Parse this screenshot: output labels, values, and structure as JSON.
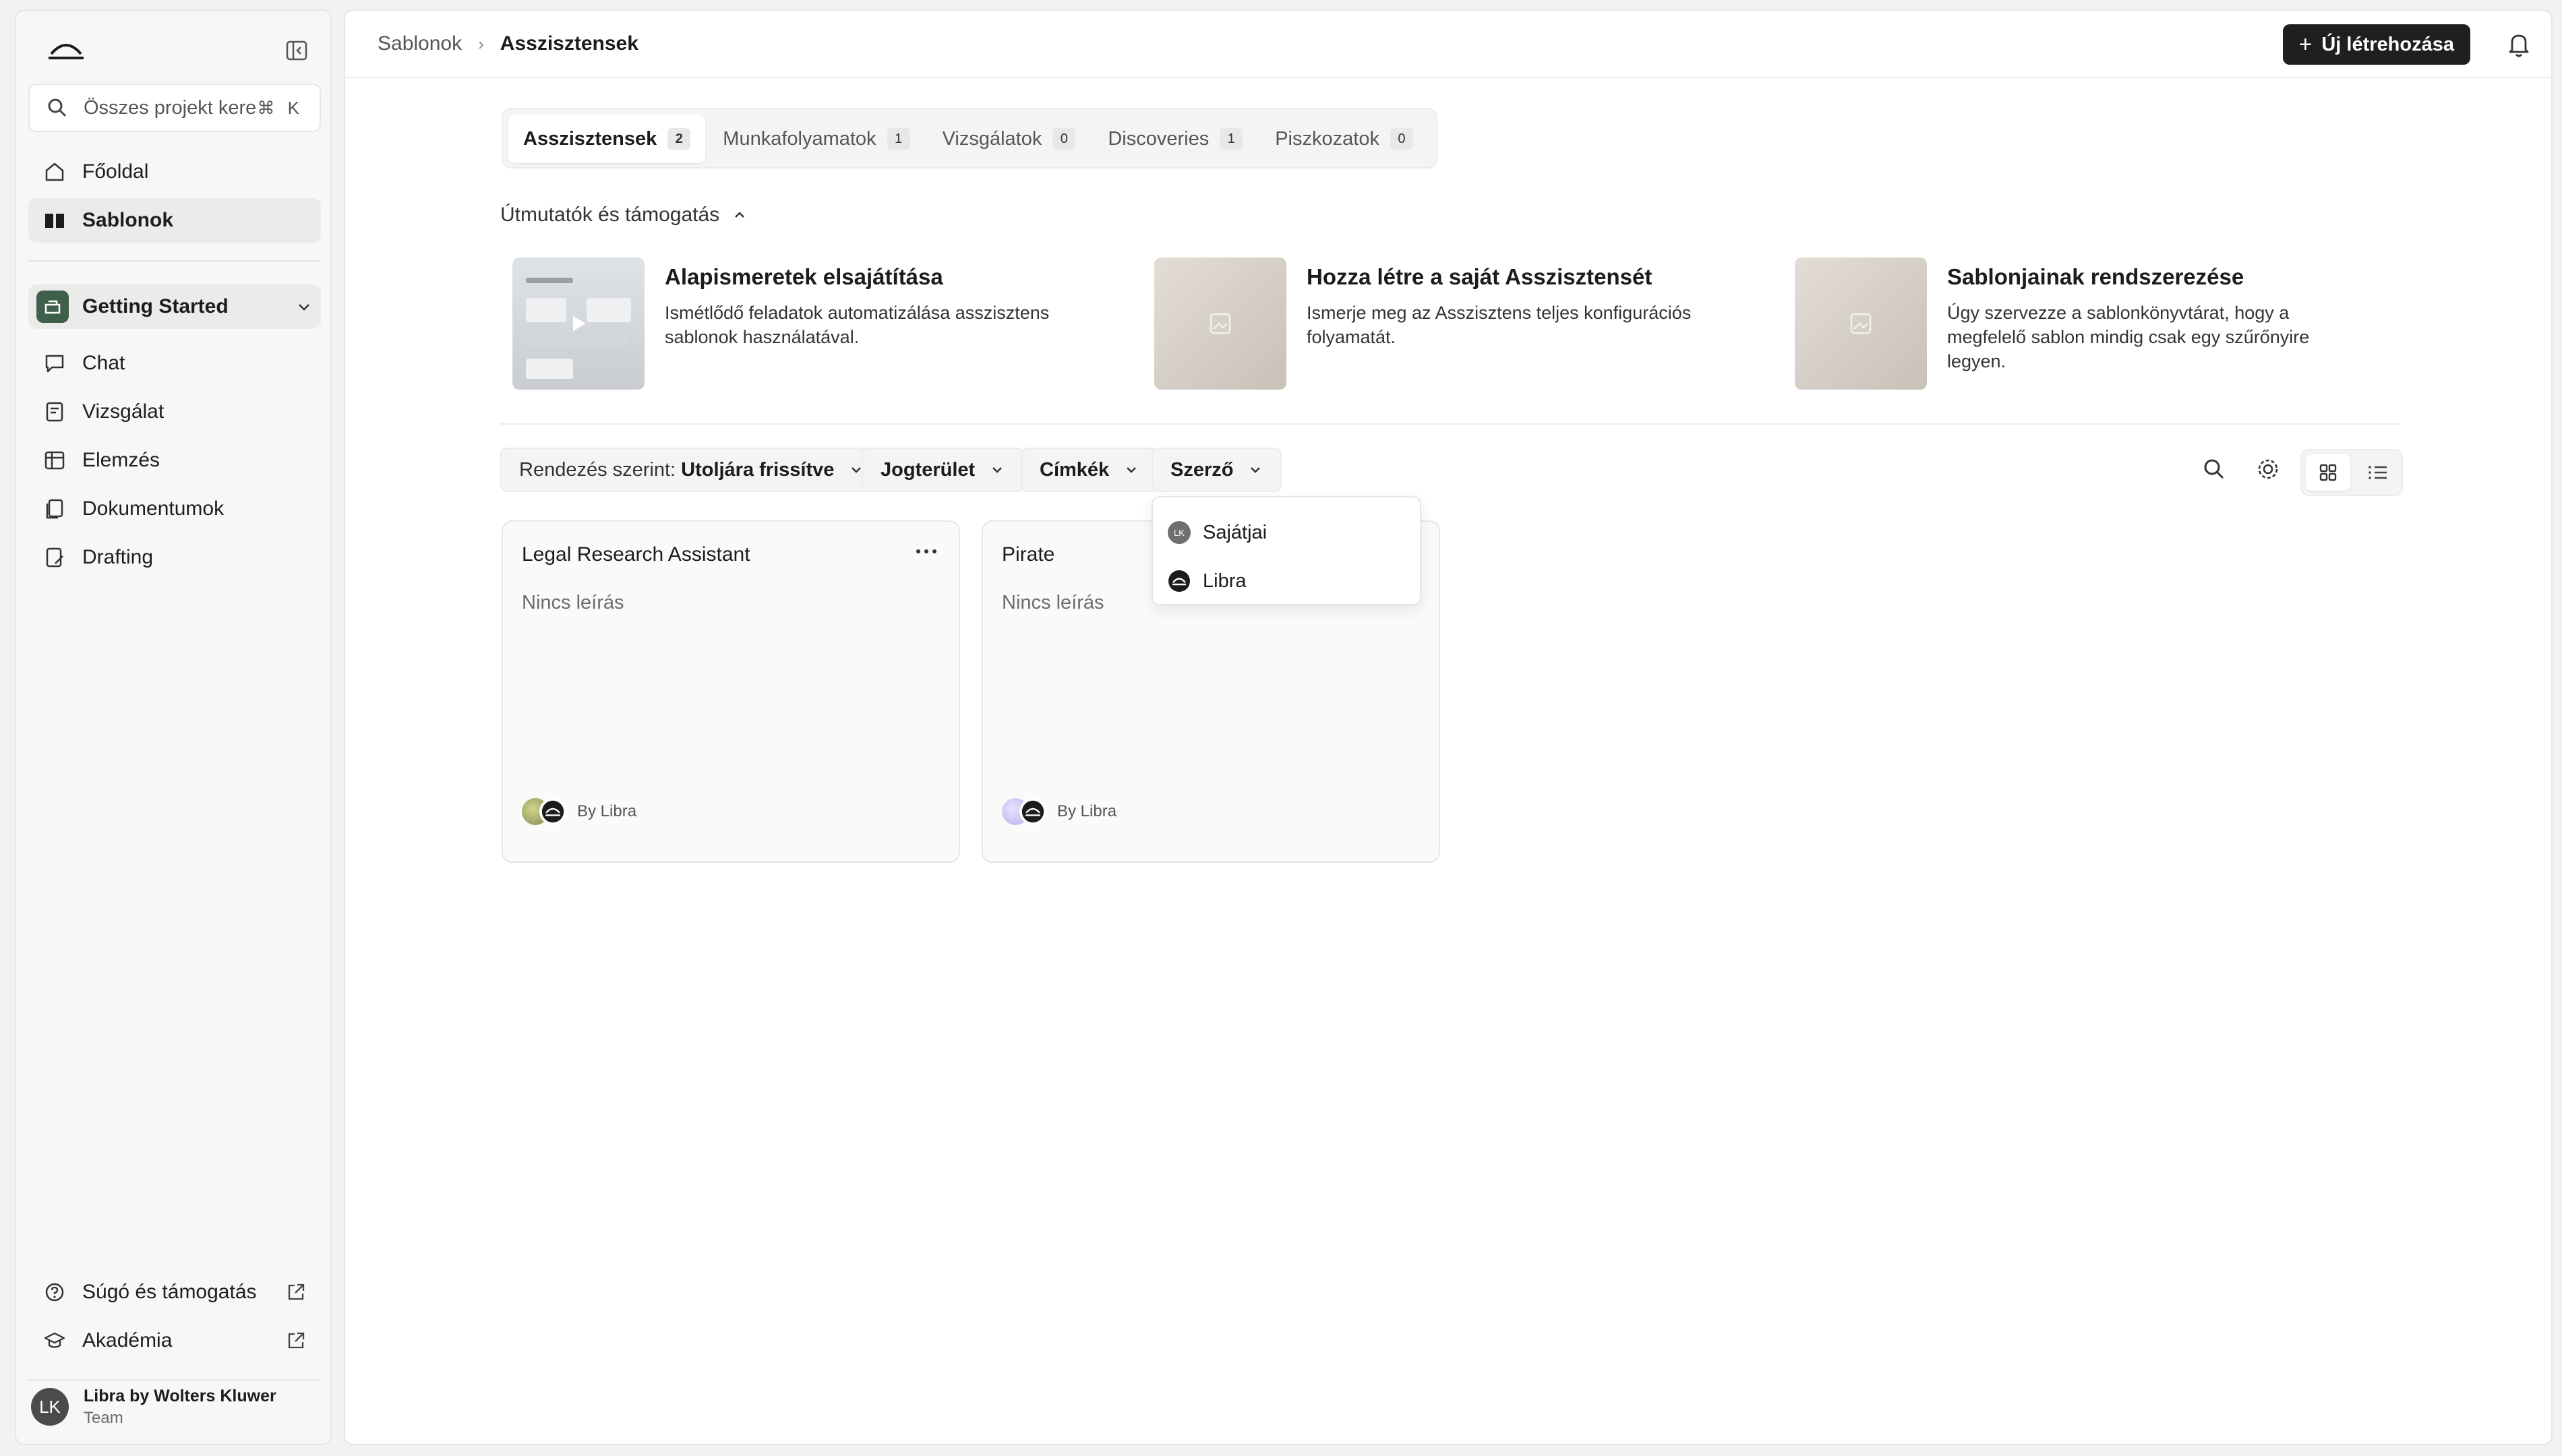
{
  "sidebar": {
    "search_placeholder": "Összes projekt kere...",
    "search_shortcut": "⌘ K",
    "nav": [
      {
        "label": "Főoldal",
        "icon": "home-icon"
      },
      {
        "label": "Sablonok",
        "icon": "book-icon"
      }
    ],
    "project": {
      "name": "Getting Started"
    },
    "project_nav": [
      {
        "label": "Chat",
        "icon": "chat-icon"
      },
      {
        "label": "Vizsgálat",
        "icon": "review-icon"
      },
      {
        "label": "Elemzés",
        "icon": "table-icon"
      },
      {
        "label": "Dokumentumok",
        "icon": "documents-icon"
      },
      {
        "label": "Drafting",
        "icon": "drafting-icon"
      }
    ],
    "footer_links": [
      {
        "label": "Súgó és támogatás",
        "icon": "help-icon"
      },
      {
        "label": "Akadémia",
        "icon": "academy-icon"
      }
    ],
    "user": {
      "initials": "LK",
      "name": "Libra by Wolters Kluwer",
      "role": "Team"
    }
  },
  "header": {
    "breadcrumb": [
      "Sablonok",
      "Asszisztensek"
    ],
    "new_button": "Új létrehozása"
  },
  "tabs": [
    {
      "label": "Asszisztensek",
      "count": "2"
    },
    {
      "label": "Munkafolyamatok",
      "count": "1"
    },
    {
      "label": "Vizsgálatok",
      "count": "0"
    },
    {
      "label": "Discoveries",
      "count": "1"
    },
    {
      "label": "Piszkozatok",
      "count": "0"
    }
  ],
  "guides": {
    "header": "Útmutatók és támogatás",
    "items": [
      {
        "title": "Alapismeretek elsajátítása",
        "desc": "Ismétlődő feladatok automatizálása asszisztens sablonok használatával."
      },
      {
        "title": "Hozza létre a saját Asszisztensét",
        "desc": "Ismerje meg az Asszisztens teljes konfigurációs folyamatát."
      },
      {
        "title": "Sablonjainak rendszerezése",
        "desc": "Úgy szervezze a sablonkönyvtárat, hogy a megfelelő sablon mindig csak egy szűrőnyire legyen."
      }
    ]
  },
  "filters": {
    "sort_label": "Rendezés szerint:",
    "sort_value": "Utoljára frissítve",
    "area": "Jogterület",
    "tags": "Címkék",
    "author": "Szerző"
  },
  "author_menu": [
    {
      "label": "Sajátjai",
      "initials": "LK"
    },
    {
      "label": "Libra"
    }
  ],
  "cards": [
    {
      "title": "Legal Research Assistant",
      "desc": "Nincs leírás",
      "by": "By Libra"
    },
    {
      "title": "Pirate",
      "desc": "Nincs leírás",
      "by": "By Libra"
    }
  ]
}
